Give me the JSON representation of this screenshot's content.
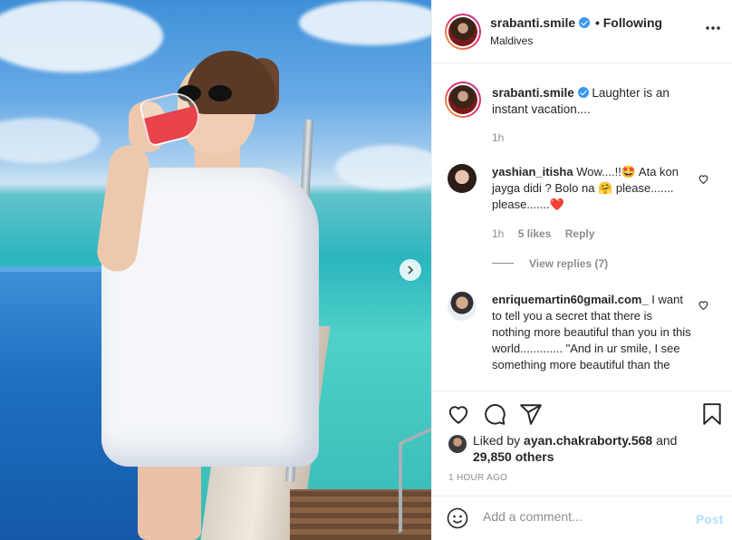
{
  "post": {
    "username": "srabanti.smile",
    "location": "Maldives",
    "following_label": "Following",
    "dot": "•",
    "more_icon": "ellipsis-icon"
  },
  "caption": {
    "username": "srabanti.smile",
    "text": "Laughter is an instant vacation....",
    "time": "1h"
  },
  "comments": [
    {
      "username": "yashian_itisha",
      "text": "Wow....!!🤩 Ata kon jayga didi ? Bolo na 🤗 please....... please.......❤️",
      "time": "1h",
      "likes": "5 likes",
      "reply_label": "Reply",
      "view_replies": "View replies (7)"
    },
    {
      "username": "enriquemartin60gmail.com_",
      "text": "I want to tell you a secret that there is nothing more beautiful than you in this world............. \"And in ur smile, I see something more beautiful than the"
    }
  ],
  "likes": {
    "prefix": "Liked by",
    "liker": "ayan.chakraborty.568",
    "and": "and",
    "others": "29,850 others"
  },
  "time_ago": "1 HOUR AGO",
  "add_comment": {
    "placeholder": "Add a comment...",
    "post_label": "Post"
  },
  "colors": {
    "text": "#262626",
    "muted": "#8e8e8e",
    "verified": "#3897f0",
    "post_disabled": "#b2dffc",
    "heart_red": "#ed4956"
  },
  "icons": [
    "verified-badge-icon",
    "ellipsis-icon",
    "chevron-right-icon",
    "heart-icon",
    "comment-icon",
    "share-icon",
    "bookmark-icon",
    "emoji-icon"
  ]
}
